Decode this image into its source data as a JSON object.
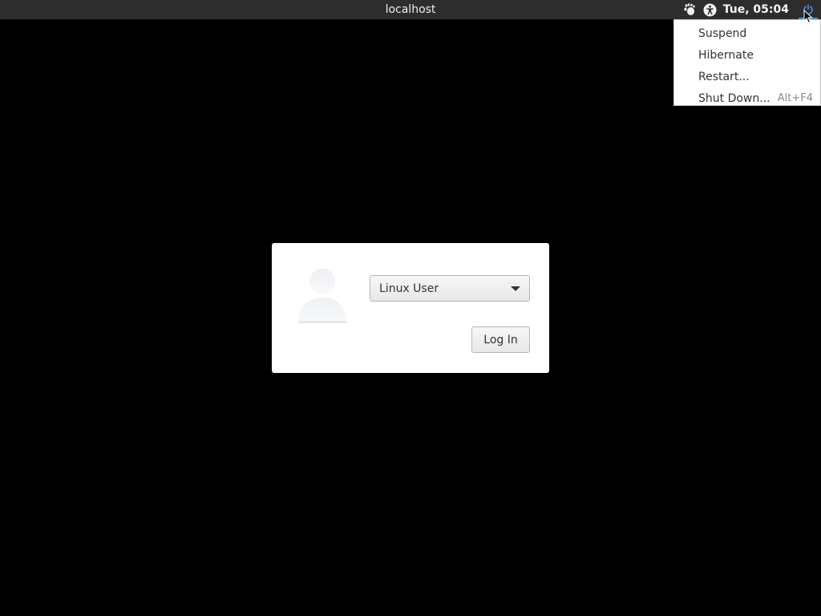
{
  "panel": {
    "hostname": "localhost",
    "clock": "Tue, 05:04",
    "icons": [
      "gnome-foot-icon",
      "accessibility-icon",
      "power-icon"
    ]
  },
  "power_menu": {
    "items": [
      {
        "label": "Suspend",
        "accel": ""
      },
      {
        "label": "Hibernate",
        "accel": ""
      },
      {
        "label": "Restart...",
        "accel": ""
      },
      {
        "label": "Shut Down...",
        "accel": "Alt+F4"
      }
    ]
  },
  "login": {
    "selected_user": "Linux User",
    "login_button": "Log In"
  },
  "colors": {
    "background": "#000000",
    "panel": "#2d2d2d",
    "accent": "#4a90d9"
  }
}
